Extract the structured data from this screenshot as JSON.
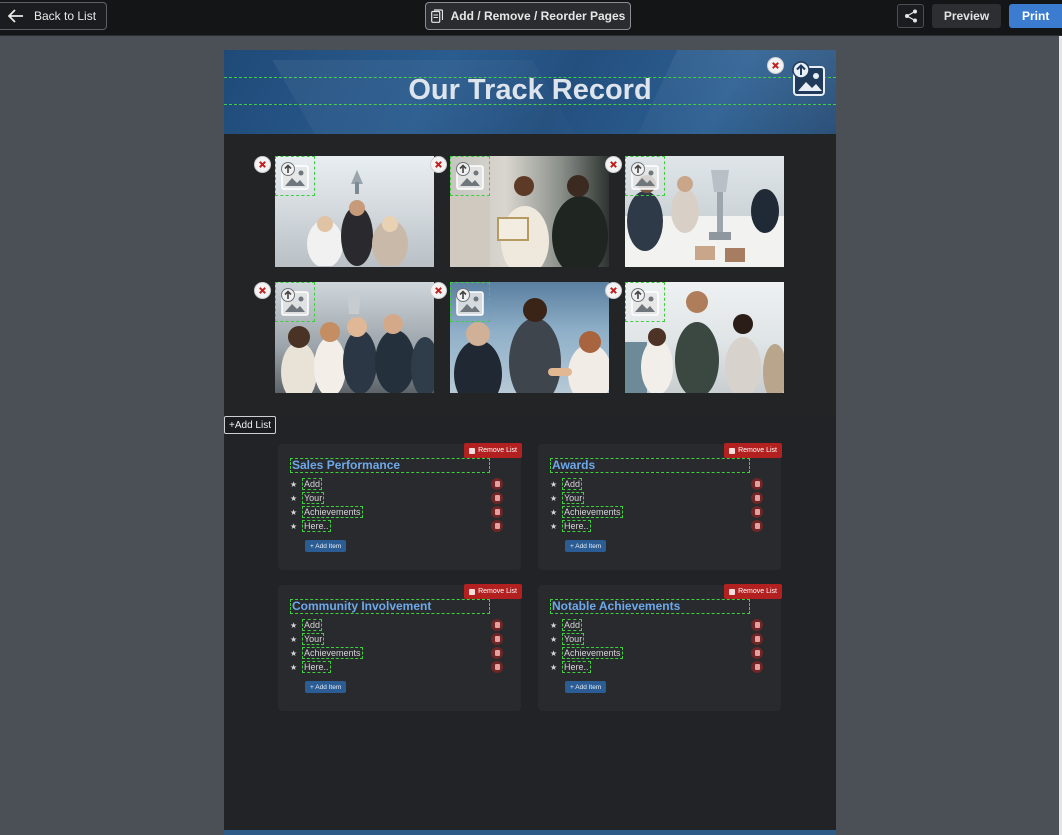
{
  "toolbar": {
    "back_label": "Back to List",
    "reorder_label": "Add / Remove / Reorder Pages",
    "preview_label": "Preview",
    "print_label": "Print",
    "accent_color": "#3b7bd0"
  },
  "page": {
    "title": "Our Track Record",
    "add_list_label": "+Add List"
  },
  "gallery": {
    "photos": [
      {
        "alt": "team raising trophy"
      },
      {
        "alt": "award certificate handshake"
      },
      {
        "alt": "trophy on meeting table"
      },
      {
        "alt": "team celebrating with trophy"
      },
      {
        "alt": "business handshake"
      },
      {
        "alt": "team applauding"
      }
    ]
  },
  "lists": [
    {
      "title": "Sales Performance",
      "remove_label": "Remove List",
      "add_item_label": "+ Add Item",
      "items": [
        "Add",
        "Your",
        "Achievements",
        "Here.."
      ]
    },
    {
      "title": "Awards",
      "remove_label": "Remove List",
      "add_item_label": "+ Add Item",
      "items": [
        "Add",
        "Your",
        "Achievements",
        "Here.."
      ]
    },
    {
      "title": "Community Involvement",
      "remove_label": "Remove List",
      "add_item_label": "+ Add Item",
      "items": [
        "Add",
        "Your",
        "Achievements",
        "Here.."
      ]
    },
    {
      "title": "Notable Achievements",
      "remove_label": "Remove List",
      "add_item_label": "+ Add Item",
      "items": [
        "Add",
        "Your",
        "Achievements",
        "Here.."
      ]
    }
  ],
  "icons": {
    "back": "arrow-left-icon",
    "reorder": "pages-icon",
    "share": "share-icon",
    "upload": "image-upload-icon",
    "remove": "close-icon",
    "trash": "trash-icon",
    "star": "star-icon"
  }
}
